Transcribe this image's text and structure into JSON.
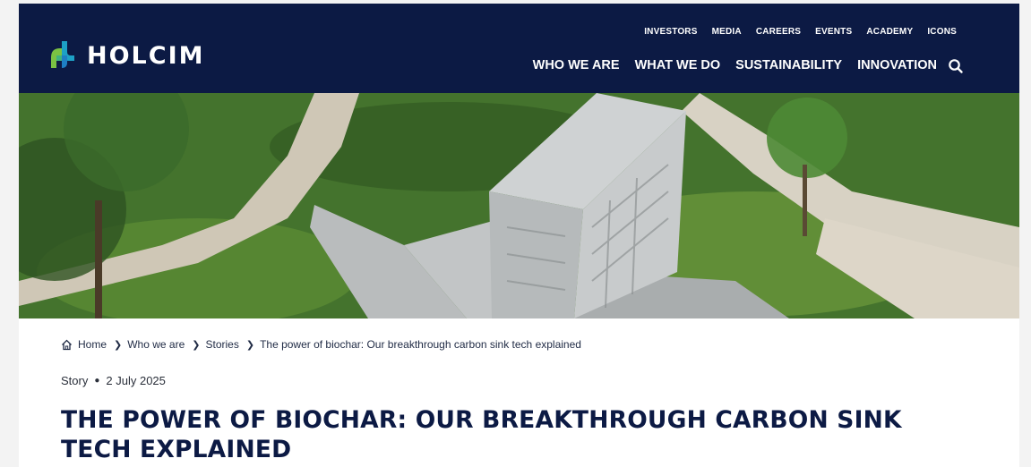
{
  "brand": {
    "name": "HOLCIM",
    "primary": "#0c1a44",
    "green": "#7ac143",
    "teal": "#1da1c6"
  },
  "top_nav": [
    {
      "label": "INVESTORS"
    },
    {
      "label": "MEDIA"
    },
    {
      "label": "CAREERS"
    },
    {
      "label": "EVENTS"
    },
    {
      "label": "ACADEMY"
    },
    {
      "label": "ICONS"
    }
  ],
  "main_nav": [
    {
      "label": "WHO WE ARE"
    },
    {
      "label": "WHAT WE DO"
    },
    {
      "label": "SUSTAINABILITY"
    },
    {
      "label": "INNOVATION"
    }
  ],
  "icons": {
    "search": "search-icon",
    "home": "home-icon",
    "chevron": "chevron-right-icon"
  },
  "breadcrumb": [
    {
      "label": "Home"
    },
    {
      "label": "Who we are"
    },
    {
      "label": "Stories"
    },
    {
      "label": "The power of biochar: Our breakthrough carbon sink tech explained"
    }
  ],
  "article": {
    "type": "Story",
    "date": "2 July 2025",
    "title": "THE POWER OF BIOCHAR: OUR BREAKTHROUGH CARBON SINK TECH EXPLAINED"
  }
}
